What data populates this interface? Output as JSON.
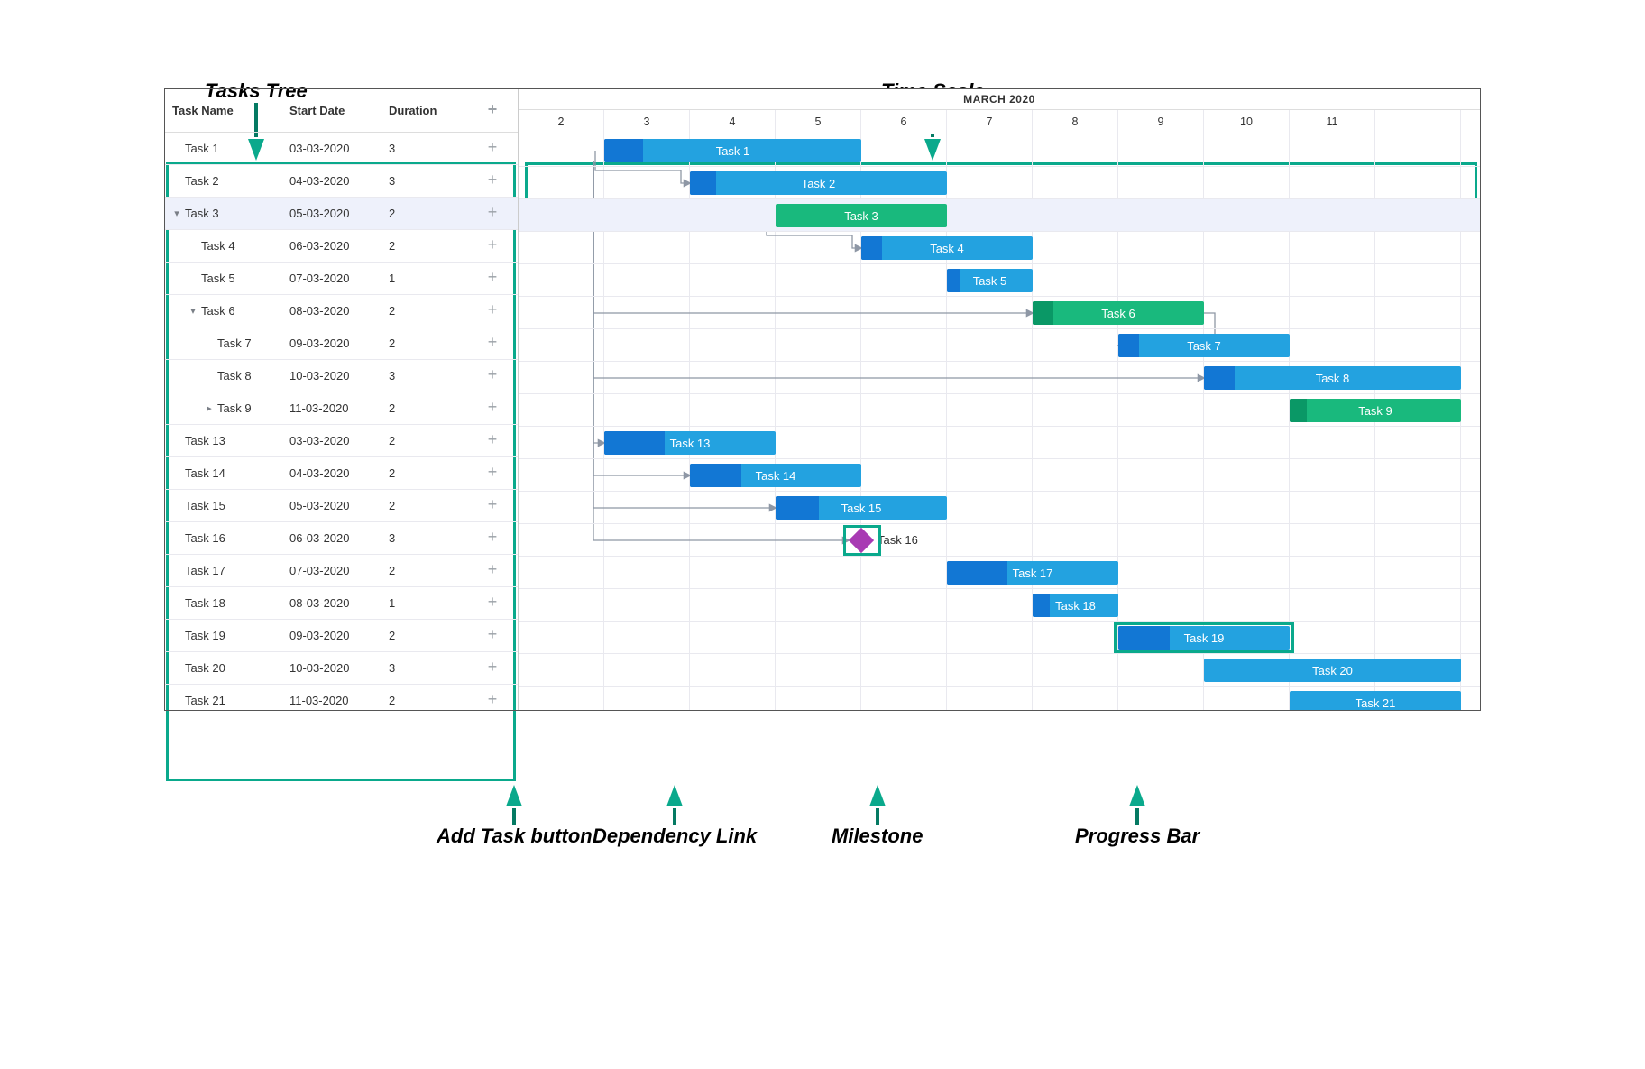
{
  "callouts": {
    "tasks_tree": "Tasks Tree",
    "time_scale": "Time Scale",
    "add_task": "Add Task button",
    "dependency": "Dependency Link",
    "milestone": "Milestone",
    "progress": "Progress Bar"
  },
  "columns": {
    "name": "Task Name",
    "start": "Start Date",
    "duration": "Duration"
  },
  "time_header": {
    "month": "MARCH 2020",
    "days": [
      2,
      3,
      4,
      5,
      6,
      7,
      8,
      9,
      10,
      11
    ]
  },
  "colors": {
    "accent": "#0aa98c",
    "bar_blue": "#23a2e0",
    "bar_green": "#19b97d",
    "milestone": "#a83ab3"
  },
  "tasks": [
    {
      "id": 1,
      "level": 0,
      "exp": "",
      "name": "Task 1",
      "start": "03-03-2020",
      "duration": 3,
      "startDay": 3,
      "barDur": 3,
      "type": "bar",
      "color": "blue",
      "progress": 15
    },
    {
      "id": 2,
      "level": 0,
      "exp": "",
      "name": "Task 2",
      "start": "04-03-2020",
      "duration": 3,
      "startDay": 4,
      "barDur": 3,
      "type": "bar",
      "color": "blue",
      "progress": 10
    },
    {
      "id": 3,
      "level": 0,
      "exp": "down",
      "name": "Task 3",
      "start": "05-03-2020",
      "duration": 2,
      "startDay": 5,
      "barDur": 2,
      "type": "bar",
      "color": "green",
      "progress": 0,
      "selected": true
    },
    {
      "id": 4,
      "level": 1,
      "exp": "",
      "name": "Task 4",
      "start": "06-03-2020",
      "duration": 2,
      "startDay": 6,
      "barDur": 2,
      "type": "bar",
      "color": "blue",
      "progress": 12
    },
    {
      "id": 5,
      "level": 1,
      "exp": "",
      "name": "Task 5",
      "start": "07-03-2020",
      "duration": 1,
      "startDay": 7,
      "barDur": 1,
      "type": "bar",
      "color": "blue",
      "progress": 15
    },
    {
      "id": 6,
      "level": 1,
      "exp": "down",
      "name": "Task 6",
      "start": "08-03-2020",
      "duration": 2,
      "startDay": 8,
      "barDur": 2,
      "type": "bar",
      "color": "green",
      "progress": 12
    },
    {
      "id": 7,
      "level": 2,
      "exp": "",
      "name": "Task 7",
      "start": "09-03-2020",
      "duration": 2,
      "startDay": 9,
      "barDur": 2,
      "type": "bar",
      "color": "blue",
      "progress": 12
    },
    {
      "id": 8,
      "level": 2,
      "exp": "",
      "name": "Task 8",
      "start": "10-03-2020",
      "duration": 3,
      "startDay": 10,
      "barDur": 3,
      "type": "bar",
      "color": "blue",
      "progress": 12
    },
    {
      "id": 9,
      "level": 2,
      "exp": "right",
      "name": "Task 9",
      "start": "11-03-2020",
      "duration": 2,
      "startDay": 11,
      "barDur": 2,
      "type": "bar",
      "color": "green",
      "progress": 10
    },
    {
      "id": 13,
      "level": 0,
      "exp": "",
      "name": "Task 13",
      "start": "03-03-2020",
      "duration": 2,
      "startDay": 3,
      "barDur": 2,
      "type": "bar",
      "color": "blue",
      "progress": 35
    },
    {
      "id": 14,
      "level": 0,
      "exp": "",
      "name": "Task 14",
      "start": "04-03-2020",
      "duration": 2,
      "startDay": 4,
      "barDur": 2,
      "type": "bar",
      "color": "blue",
      "progress": 30
    },
    {
      "id": 15,
      "level": 0,
      "exp": "",
      "name": "Task 15",
      "start": "05-03-2020",
      "duration": 2,
      "startDay": 5,
      "barDur": 2,
      "type": "bar",
      "color": "blue",
      "progress": 25
    },
    {
      "id": 16,
      "level": 0,
      "exp": "",
      "name": "Task 16",
      "start": "06-03-2020",
      "duration": 3,
      "startDay": 6,
      "barDur": 0,
      "type": "milestone"
    },
    {
      "id": 17,
      "level": 0,
      "exp": "",
      "name": "Task 17",
      "start": "07-03-2020",
      "duration": 2,
      "startDay": 7,
      "barDur": 2,
      "type": "bar",
      "color": "blue",
      "progress": 35
    },
    {
      "id": 18,
      "level": 0,
      "exp": "",
      "name": "Task 18",
      "start": "08-03-2020",
      "duration": 1,
      "startDay": 8,
      "barDur": 1,
      "type": "bar",
      "color": "blue",
      "progress": 20
    },
    {
      "id": 19,
      "level": 0,
      "exp": "",
      "name": "Task 19",
      "start": "09-03-2020",
      "duration": 2,
      "startDay": 9,
      "barDur": 2,
      "type": "bar",
      "color": "blue",
      "progress": 30,
      "highlight": true
    },
    {
      "id": 20,
      "level": 0,
      "exp": "",
      "name": "Task 20",
      "start": "10-03-2020",
      "duration": 3,
      "startDay": 10,
      "barDur": 3,
      "type": "bar",
      "color": "blue",
      "progress": 0
    },
    {
      "id": 21,
      "level": 0,
      "exp": "",
      "name": "Task 21",
      "start": "11-03-2020",
      "duration": 2,
      "startDay": 11,
      "barDur": 2,
      "type": "bar",
      "color": "blue",
      "progress": 0
    }
  ],
  "links": [
    {
      "from": 1,
      "to": 2,
      "mode": "ss"
    },
    {
      "from": 1,
      "to": 3,
      "mode": "corner"
    },
    {
      "from": 3,
      "to": 4,
      "mode": "ss"
    },
    {
      "from": 1,
      "to": 6,
      "mode": "corner"
    },
    {
      "from": 6,
      "to": 7,
      "mode": "end"
    },
    {
      "from": 1,
      "to": 8,
      "mode": "corner"
    },
    {
      "from": 1,
      "to": 13,
      "mode": "corner"
    },
    {
      "from": 1,
      "to": 14,
      "mode": "corner"
    },
    {
      "from": 1,
      "to": 15,
      "mode": "corner"
    },
    {
      "from": 1,
      "to": 16,
      "mode": "corner"
    }
  ]
}
